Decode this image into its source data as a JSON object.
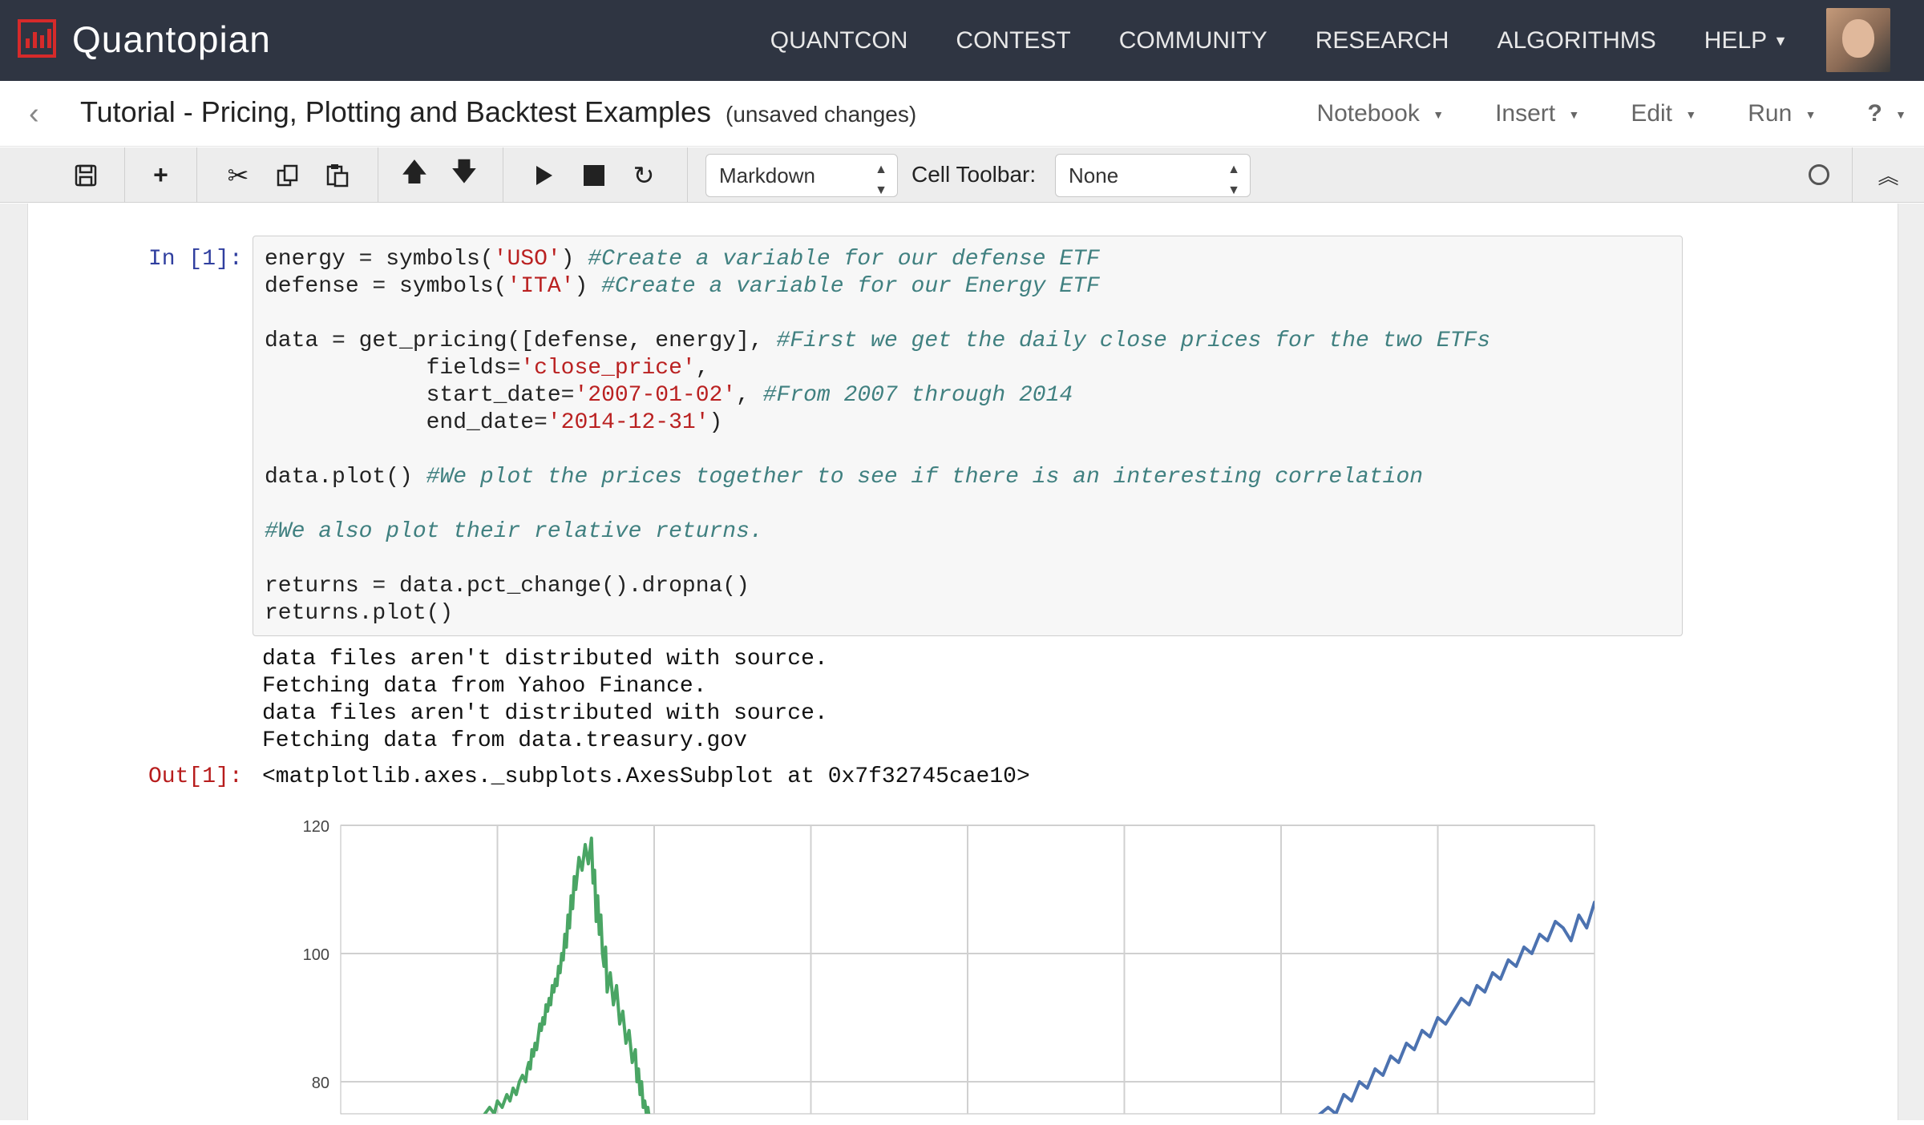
{
  "brand": "Quantopian",
  "nav": [
    "QUANTCON",
    "CONTEST",
    "COMMUNITY",
    "RESEARCH",
    "ALGORITHMS",
    "HELP"
  ],
  "notebook": {
    "title": "Tutorial - Pricing, Plotting and Backtest Examples",
    "status": "(unsaved changes)"
  },
  "menus": [
    "Notebook",
    "Insert",
    "Edit",
    "Run",
    "?"
  ],
  "toolbar": {
    "cell_type": "Markdown",
    "cell_toolbar_label": "Cell Toolbar:",
    "cell_toolbar_value": "None"
  },
  "cell": {
    "in_prompt": "In [1]:",
    "out_prompt": "Out[1]:",
    "code_lines": [
      [
        [
          "t",
          "energy = symbols("
        ],
        [
          "s",
          "'USO'"
        ],
        [
          "t",
          ") "
        ],
        [
          "c",
          "#Create a variable for our defense ETF"
        ]
      ],
      [
        [
          "t",
          "defense = symbols("
        ],
        [
          "s",
          "'ITA'"
        ],
        [
          "t",
          ") "
        ],
        [
          "c",
          "#Create a variable for our Energy ETF"
        ]
      ],
      [
        [
          "t",
          ""
        ]
      ],
      [
        [
          "t",
          "data = get_pricing([defense, energy], "
        ],
        [
          "c",
          "#First we get the daily close prices for the two ETFs"
        ]
      ],
      [
        [
          "t",
          "            fields="
        ],
        [
          "s",
          "'close_price'"
        ],
        [
          "t",
          ","
        ]
      ],
      [
        [
          "t",
          "            start_date="
        ],
        [
          "s",
          "'2007-01-02'"
        ],
        [
          "t",
          ", "
        ],
        [
          "c",
          "#From 2007 through 2014"
        ]
      ],
      [
        [
          "t",
          "            end_date="
        ],
        [
          "s",
          "'2014-12-31'"
        ],
        [
          "t",
          ")"
        ]
      ],
      [
        [
          "t",
          ""
        ]
      ],
      [
        [
          "t",
          "data.plot() "
        ],
        [
          "c",
          "#We plot the prices together to see if there is an interesting correlation"
        ]
      ],
      [
        [
          "t",
          ""
        ]
      ],
      [
        [
          "c",
          "#We also plot their relative returns."
        ]
      ],
      [
        [
          "t",
          ""
        ]
      ],
      [
        [
          "t",
          "returns = data.pct_change().dropna()"
        ]
      ],
      [
        [
          "t",
          "returns.plot()"
        ]
      ]
    ],
    "stream_lines": [
      "data files aren't distributed with source.",
      "Fetching data from Yahoo Finance.",
      "data files aren't distributed with source.",
      "Fetching data from data.treasury.gov"
    ],
    "out_text": "<matplotlib.axes._subplots.AxesSubplot at 0x7f32745cae10>"
  },
  "chart_data": {
    "type": "line",
    "ylim": [
      75,
      120
    ],
    "yticks": [
      120,
      100,
      80
    ],
    "grid": true,
    "colors": {
      "green": "#4aa564",
      "blue": "#4c72b0"
    },
    "series": [
      {
        "color": "green",
        "x": [
          0.89,
          0.92,
          0.95,
          0.98,
          1.0,
          1.03,
          1.06,
          1.08,
          1.1,
          1.12,
          1.14,
          1.16,
          1.18,
          1.19,
          1.2,
          1.21,
          1.22,
          1.23,
          1.24,
          1.25,
          1.26,
          1.27,
          1.28,
          1.29,
          1.3,
          1.31,
          1.32,
          1.33,
          1.34,
          1.35,
          1.36,
          1.37,
          1.38,
          1.39,
          1.4,
          1.41,
          1.42,
          1.43,
          1.44,
          1.45,
          1.46,
          1.47,
          1.48,
          1.49,
          1.5,
          1.52,
          1.54,
          1.56,
          1.58,
          1.6,
          1.61,
          1.62,
          1.63,
          1.64,
          1.65,
          1.66,
          1.67,
          1.68,
          1.69,
          1.7,
          1.72,
          1.74,
          1.76,
          1.78,
          1.8,
          1.82,
          1.84,
          1.86,
          1.88,
          1.89,
          1.9,
          1.91,
          1.92,
          1.93,
          1.94,
          1.95,
          1.96,
          1.97,
          1.98
        ],
        "y": [
          74,
          75,
          76,
          75,
          77,
          76,
          78,
          77,
          79,
          78,
          80,
          81,
          80,
          82,
          83,
          82,
          85,
          84,
          86,
          85,
          87,
          89,
          88,
          90,
          89,
          92,
          91,
          93,
          92,
          95,
          94,
          96,
          95,
          98,
          97,
          100,
          99,
          103,
          101,
          106,
          104,
          109,
          107,
          112,
          110,
          115,
          113,
          117,
          114,
          118,
          111,
          113,
          105,
          109,
          103,
          106,
          100,
          98,
          101,
          94,
          97,
          92,
          95,
          89,
          91,
          86,
          88,
          83,
          85,
          80,
          82,
          78,
          80,
          76,
          77,
          75,
          76,
          74,
          75
        ]
      },
      {
        "color": "blue",
        "x": [
          6.2,
          6.25,
          6.3,
          6.35,
          6.4,
          6.45,
          6.5,
          6.55,
          6.6,
          6.65,
          6.7,
          6.75,
          6.8,
          6.85,
          6.9,
          6.95,
          7.0,
          7.05,
          7.1,
          7.15,
          7.2,
          7.25,
          7.3,
          7.35,
          7.4,
          7.45,
          7.5,
          7.55,
          7.6,
          7.65,
          7.7,
          7.75,
          7.8,
          7.85,
          7.9,
          7.95,
          8.0,
          8.05,
          8.1,
          8.15,
          8.2,
          8.25,
          8.3,
          8.35,
          8.4,
          8.45,
          8.5,
          8.55,
          8.6,
          8.65,
          8.7,
          8.75,
          8.8,
          8.85,
          8.9,
          8.95,
          9.0,
          9.05,
          9.1,
          9.15,
          9.2,
          9.25,
          9.3,
          9.35,
          9.4,
          9.45,
          9.5,
          9.55,
          9.6,
          9.65,
          9.7,
          9.75,
          9.8,
          9.85,
          9.9,
          9.95,
          10.0
        ],
        "y": [
          74,
          75,
          76,
          75,
          78,
          77,
          80,
          79,
          82,
          81,
          84,
          83,
          86,
          85,
          88,
          87,
          90,
          89,
          91,
          93,
          92,
          95,
          94,
          97,
          96,
          99,
          98,
          101,
          100,
          103,
          102,
          105,
          104,
          102,
          106,
          104,
          108,
          105,
          103,
          107,
          106,
          109,
          105,
          108,
          107,
          110,
          106,
          104,
          108,
          103,
          101,
          105,
          103,
          107,
          102,
          104,
          101,
          106,
          108,
          104,
          110,
          107,
          109,
          106,
          111,
          108,
          105,
          110,
          112,
          109,
          113,
          111,
          114,
          110,
          115,
          113,
          116
        ]
      }
    ]
  }
}
